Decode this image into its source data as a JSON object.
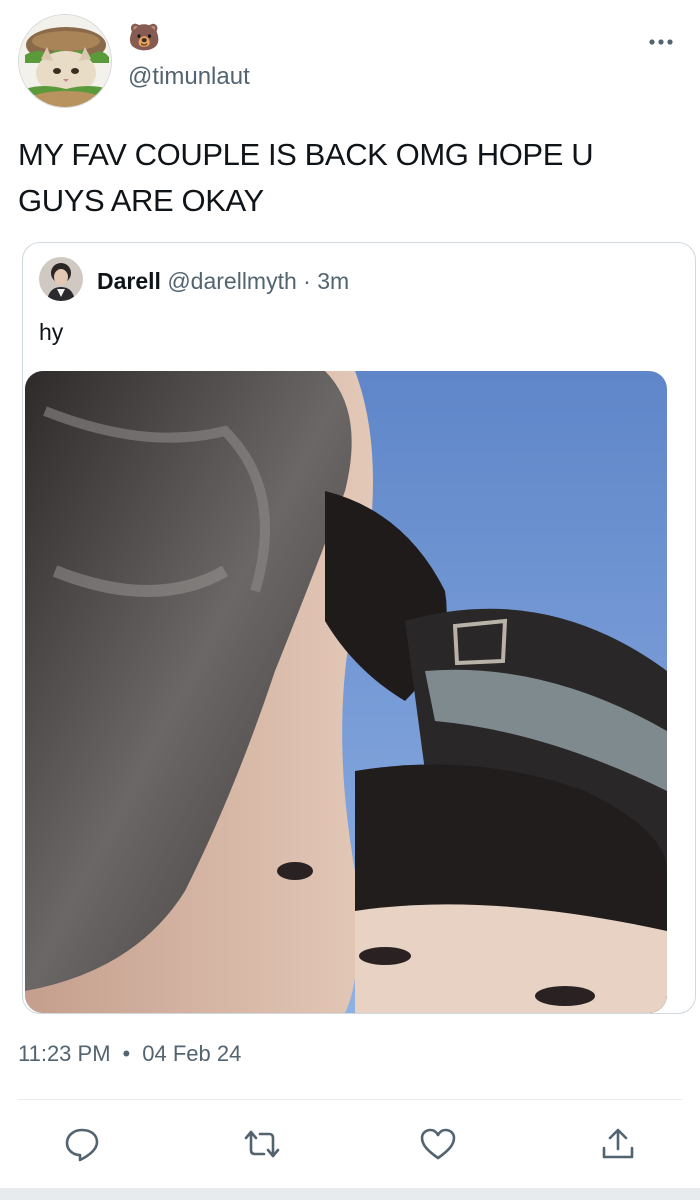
{
  "author": {
    "display_name": "🐻",
    "handle": "@timunlaut",
    "avatar_icon": "cat-in-burger-avatar"
  },
  "tweet": {
    "text": "MY FAV COUPLE IS BACK OMG HOPE U GUYS ARE OKAY",
    "time": "11:23 PM",
    "separator": "•",
    "date": "04 Feb 24"
  },
  "quoted": {
    "name": "Darell",
    "handle": "@darellmyth",
    "meta_sep": " · ",
    "age": "3m",
    "text": "hy"
  },
  "icons": {
    "more": "more-horizontal-icon",
    "reply": "reply-icon",
    "retweet": "retweet-icon",
    "like": "heart-icon",
    "share": "share-icon"
  },
  "colors": {
    "secondary_text": "#536471",
    "primary_text": "#0f1419",
    "border": "#cfd9de"
  }
}
